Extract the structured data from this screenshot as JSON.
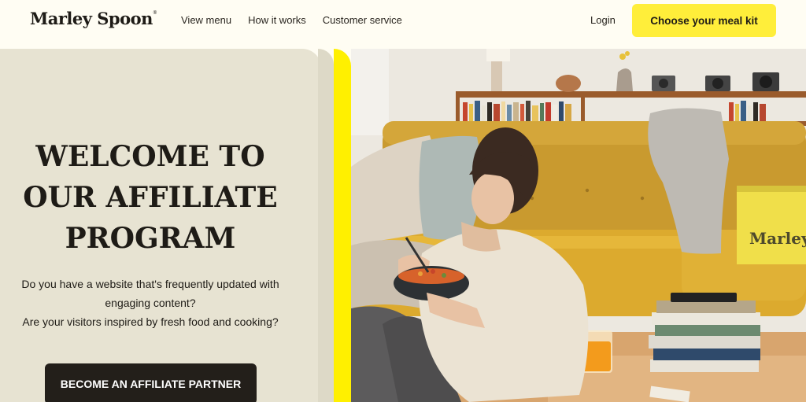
{
  "header": {
    "logo": "Marley Spoon",
    "nav": [
      "View menu",
      "How it works",
      "Customer service"
    ],
    "login": "Login",
    "cta": "Choose your meal kit"
  },
  "hero": {
    "headline": [
      "WELCOME TO",
      "OUR AFFILIATE",
      "PROGRAM"
    ],
    "body": [
      "Do you have a website that's frequently updated with",
      "engaging content?",
      "Are your visitors inspired by fresh food and cooking?"
    ],
    "button": "BECOME AN AFFILIATE PARTNER",
    "box_label": "Marley"
  },
  "colors": {
    "accent_yellow": "#ffee3a",
    "dark": "#231f1a",
    "panel": "#e7e3d2"
  }
}
